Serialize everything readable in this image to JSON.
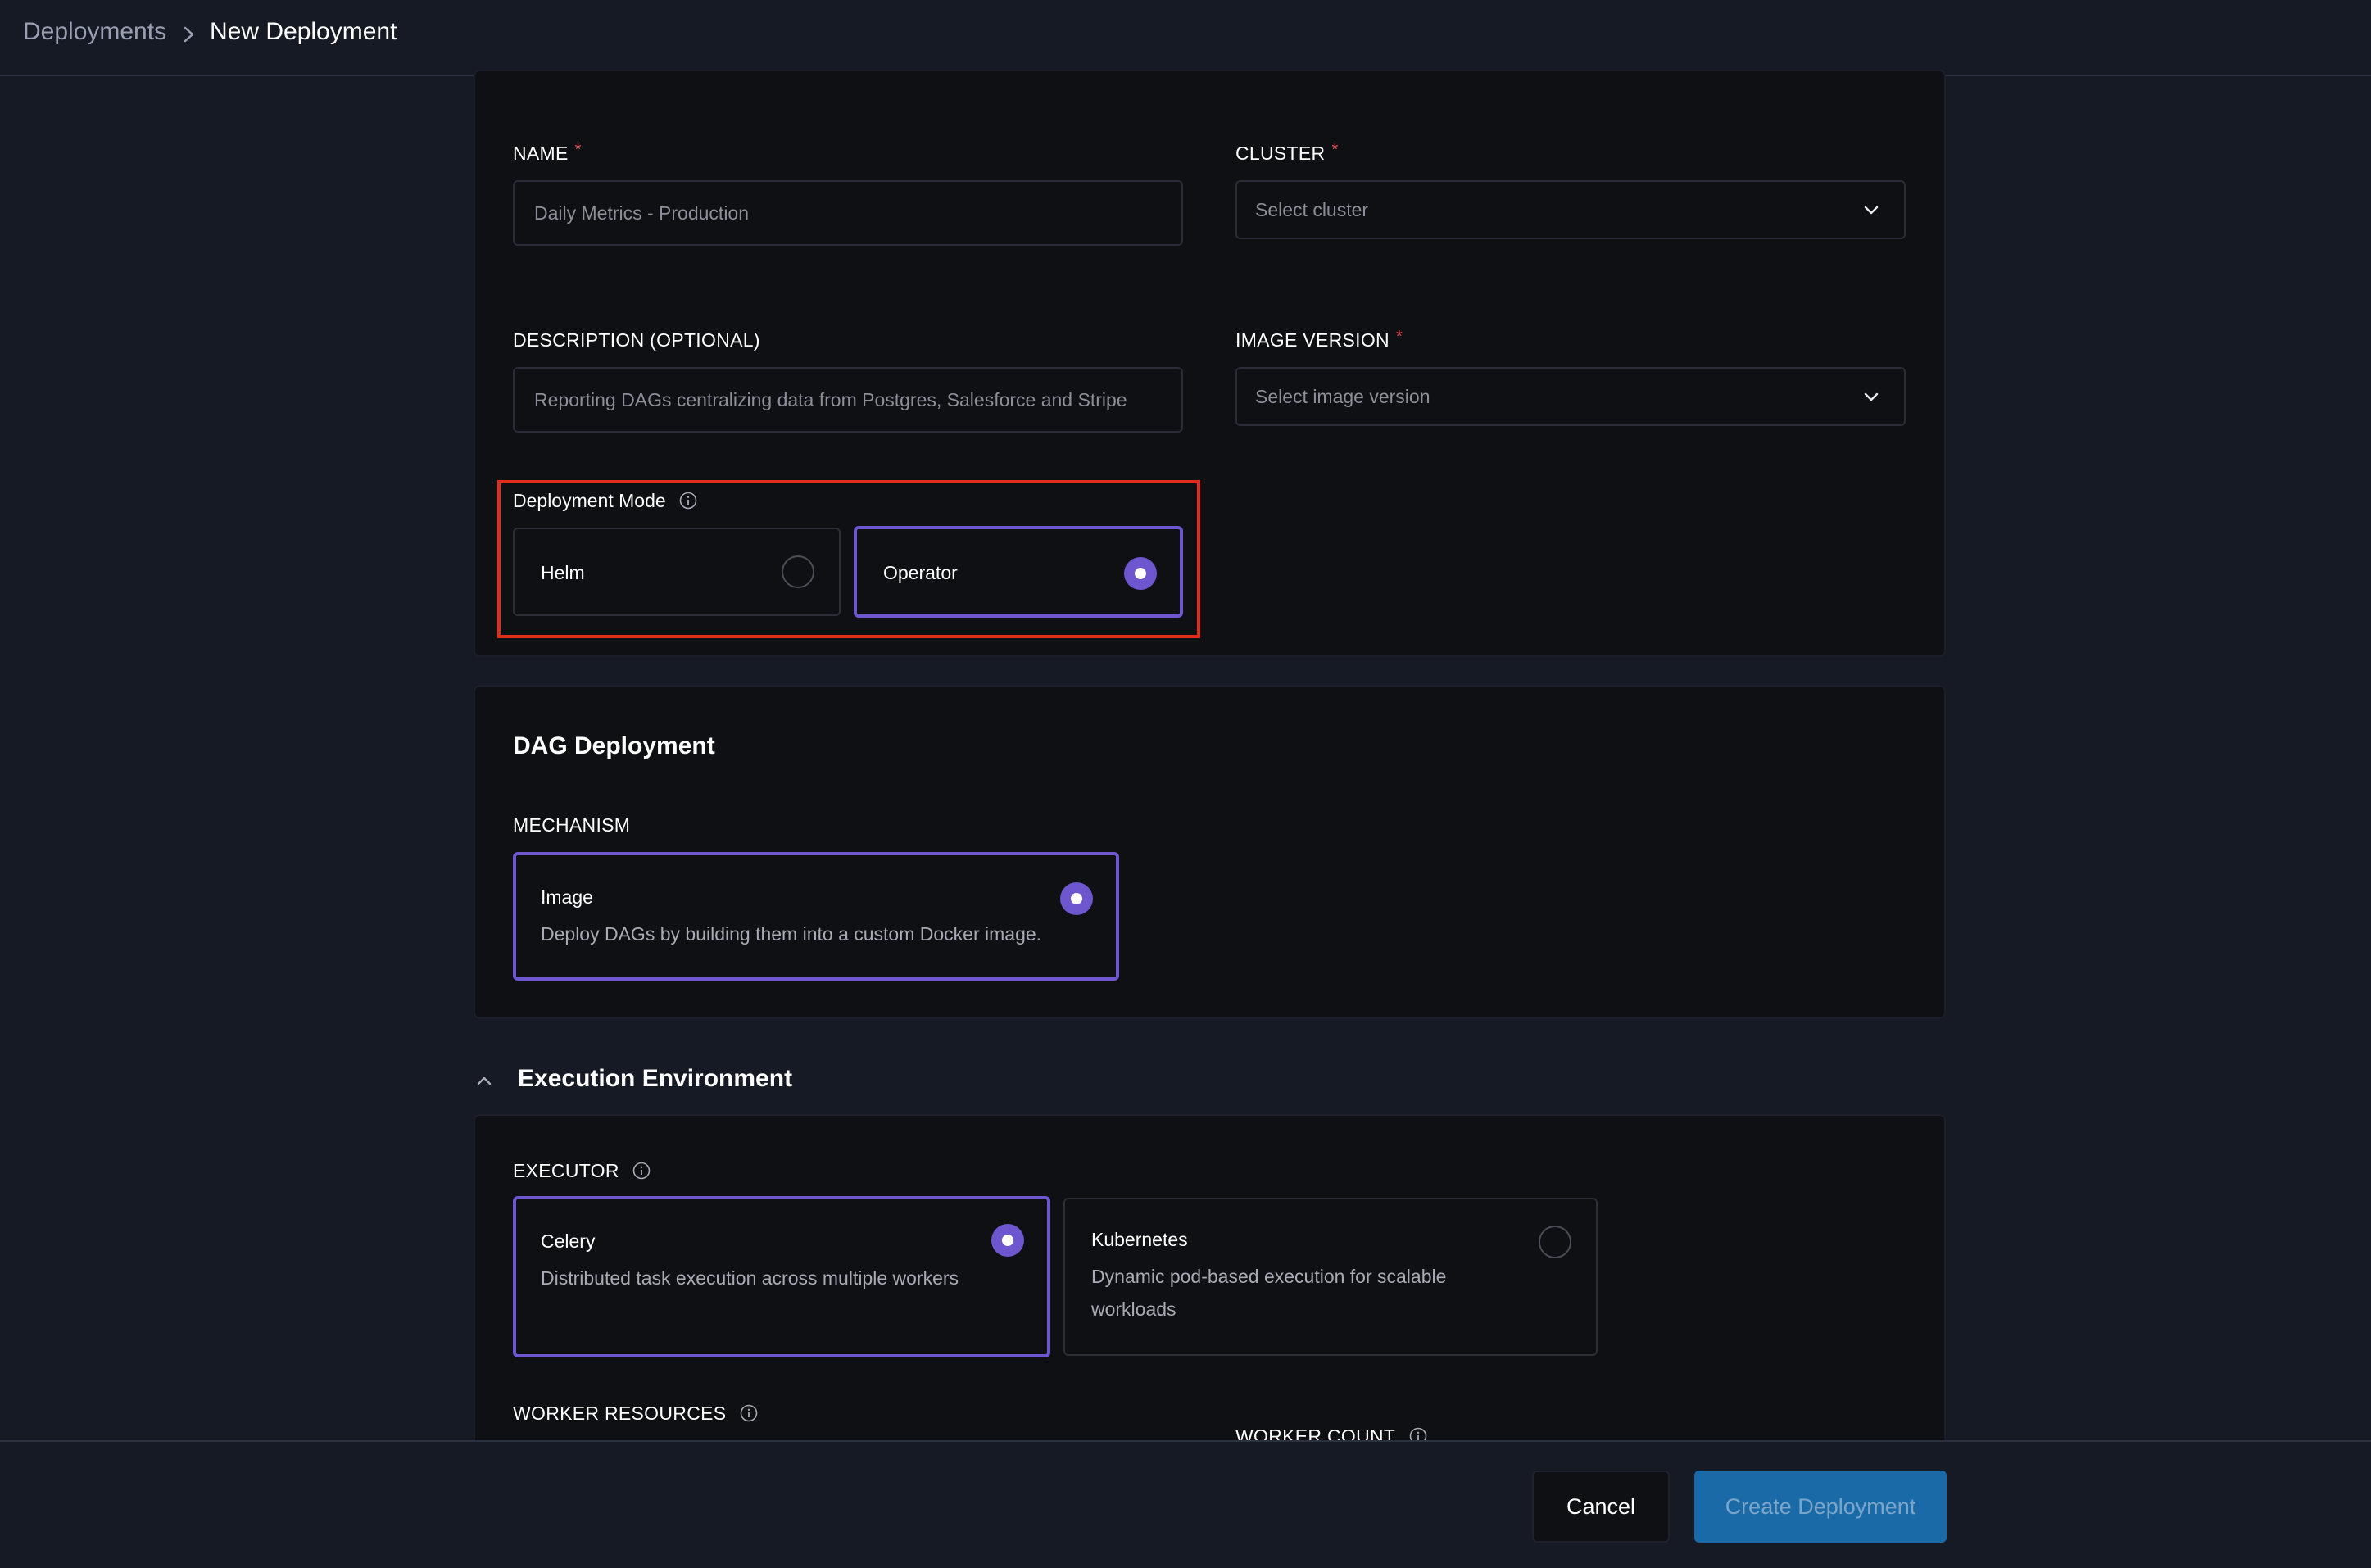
{
  "breadcrumb": {
    "parent": "Deployments",
    "current": "New Deployment"
  },
  "form": {
    "name": {
      "label": "NAME",
      "required_mark": "*",
      "value": "Daily Metrics - Production"
    },
    "cluster": {
      "label": "CLUSTER",
      "required_mark": "*",
      "placeholder": "Select cluster"
    },
    "description": {
      "label": "DESCRIPTION (OPTIONAL)",
      "value": "Reporting DAGs centralizing data from Postgres, Salesforce and Stripe"
    },
    "image_version": {
      "label": "IMAGE VERSION",
      "required_mark": "*",
      "placeholder": "Select image version"
    },
    "deployment_mode": {
      "label": "Deployment Mode",
      "options": [
        {
          "label": "Helm",
          "selected": false
        },
        {
          "label": "Operator",
          "selected": true
        }
      ]
    }
  },
  "dag_deployment": {
    "title": "DAG Deployment",
    "mechanism_label": "MECHANISM",
    "option": {
      "title": "Image",
      "description": "Deploy DAGs by building them into a custom Docker image.",
      "selected": true
    }
  },
  "execution_environment": {
    "title": "Execution Environment",
    "executor_label": "EXECUTOR",
    "executors": [
      {
        "title": "Celery",
        "description": "Distributed task execution across multiple workers",
        "selected": true
      },
      {
        "title": "Kubernetes",
        "description": "Dynamic pod-based execution for scalable workloads",
        "selected": false
      }
    ],
    "worker_resources_label": "WORKER RESOURCES",
    "worker_count_label": "WORKER COUNT"
  },
  "footer": {
    "cancel_label": "Cancel",
    "create_label": "Create Deployment"
  },
  "colors": {
    "accent": "#6e56cf",
    "primary_button": "#1b6aa8",
    "required": "#e5484d",
    "highlight_box": "#e02b1d"
  },
  "icons": [
    "chevron-right-icon",
    "chevron-down-icon",
    "info-icon",
    "chevron-up-icon"
  ]
}
